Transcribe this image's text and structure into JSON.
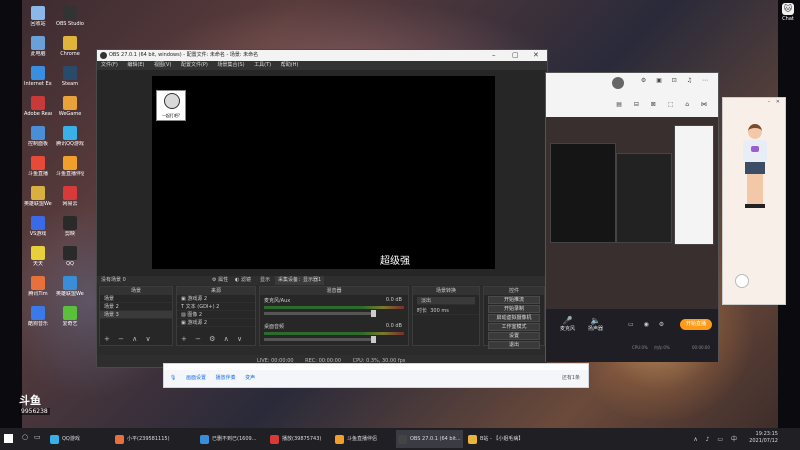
{
  "desktop": {
    "icons": [
      {
        "label": "回收站",
        "color": "#8bb8e8"
      },
      {
        "label": "OBS Studio",
        "color": "#333333"
      },
      {
        "label": "此电脑",
        "color": "#6aa0d8"
      },
      {
        "label": "Chrome",
        "color": "#e0b43a"
      },
      {
        "label": "Internet Explorer",
        "color": "#3a8ee0"
      },
      {
        "label": "Steam",
        "color": "#2a4a6a"
      },
      {
        "label": "Adobe Reader",
        "color": "#c83a3a"
      },
      {
        "label": "WeGame",
        "color": "#e8a23a"
      },
      {
        "label": "控制面板",
        "color": "#4a8ed8"
      },
      {
        "label": "腾讯QQ游戏",
        "color": "#3ab0e8"
      },
      {
        "label": "斗鱼直播",
        "color": "#e84a3a"
      },
      {
        "label": "斗鱼直播伴侣",
        "color": "#f0a02a"
      },
      {
        "label": "英雄联盟WeGame",
        "color": "#d8b040"
      },
      {
        "label": "网易云",
        "color": "#d83a3a"
      },
      {
        "label": "VS游戏",
        "color": "#3a6ae8"
      },
      {
        "label": "剪映",
        "color": "#2a2a2a"
      },
      {
        "label": "天天",
        "color": "#e8d03a"
      },
      {
        "label": "QQ",
        "color": "#2a2a2a"
      },
      {
        "label": "腾讯Tim",
        "color": "#e8703a"
      },
      {
        "label": "英雄联盟WeGame",
        "color": "#3a8ed8"
      },
      {
        "label": "酷狗音乐",
        "color": "#3a7ae8"
      },
      {
        "label": "爱奇艺",
        "color": "#5ac03a"
      }
    ],
    "corner_icon": {
      "label": "Chat",
      "glyph": "🐱"
    }
  },
  "obs": {
    "title": "OBS 27.0.1 (64 bit, windows) - 配置文件: 未命名 - 场景: 未命名",
    "menu": [
      "文件(F)",
      "编辑(E)",
      "视图(V)",
      "配置文件(P)",
      "场景集合(S)",
      "工具(T)",
      "帮助(H)"
    ],
    "preview_caption": "一起打吧?",
    "overlay_text": "超级强",
    "scene_bar": {
      "left": "没有场景 0",
      "properties": "属性",
      "filters": "滤镜",
      "display": "显示",
      "capture": "采集设备：显示器1"
    },
    "scenes": {
      "header": "场景",
      "items": [
        "场景",
        "场景 2",
        "场景 3"
      ]
    },
    "sources": {
      "header": "来源",
      "items": [
        "游戏源 2",
        "文本 (GDI+) 2",
        "图像 2",
        "游戏源 2"
      ]
    },
    "mixer": {
      "header": "混音器",
      "channels": [
        {
          "name": "麦克风/Aux",
          "db": "0.0 dB"
        },
        {
          "name": "桌面音频",
          "db": "0.0 dB"
        }
      ]
    },
    "transitions": {
      "header": "场景转换",
      "mode": "淡出",
      "duration_label": "时长",
      "duration": "300 ms"
    },
    "controls": {
      "header": "控件",
      "buttons": [
        "开始推流",
        "开始录制",
        "启动虚拟摄像机",
        "工作室模式",
        "设置",
        "退出"
      ]
    },
    "status": {
      "live": "LIVE: 00:00:00",
      "rec": "REC: 00:00:00",
      "cpu": "CPU: 0.3%, 30.00 fps"
    }
  },
  "assistant": {
    "top_icons": "⚙ ▣ ⊡ ♫ ⋯",
    "sub_icons": "▤ ⊟ ⊠ ⬚ ⌂ ⋈",
    "bottom_buttons": [
      {
        "label": "麦克风",
        "glyph": "🎤"
      },
      {
        "label": "扬声器",
        "glyph": "🔈"
      }
    ],
    "go_live": "开始直播",
    "stats": [
      "CPU:0%",
      "内存:0%",
      "00:00:00"
    ]
  },
  "chat": {
    "links": [
      "画面设置",
      "播放伴奏",
      "变声"
    ],
    "right": "还有1条"
  },
  "douyu": {
    "logo": "斗鱼",
    "room_id": "9956238"
  },
  "taskbar": {
    "tasks": [
      {
        "label": "QQ游戏",
        "color": "#3ab0e8"
      },
      {
        "label": "小平(239581115)",
        "color": "#e8703a"
      },
      {
        "label": "已删不到已(1609...",
        "color": "#3a8ed8"
      },
      {
        "label": "播放(39875743)",
        "color": "#d83a3a"
      },
      {
        "label": "斗鱼直播伴侣",
        "color": "#f0a02a"
      },
      {
        "label": "OBS 27.0.1 (64 bit...",
        "color": "#444444"
      },
      {
        "label": "B站 - 【小姐毛病】",
        "color": "#e8b43a"
      }
    ],
    "time": "19:23:15",
    "date": "2021/07/12"
  }
}
